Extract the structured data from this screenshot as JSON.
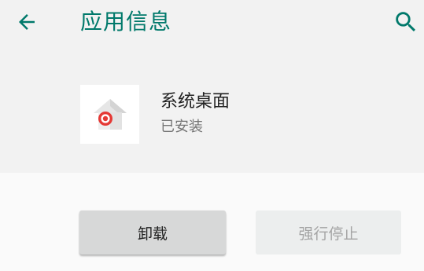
{
  "toolbar": {
    "title": "应用信息",
    "back_icon": "arrow-back-icon",
    "search_icon": "search-icon",
    "accent_color": "#00796b"
  },
  "app": {
    "icon": "home-app-icon",
    "name": "系统桌面",
    "status": "已安装"
  },
  "actions": {
    "uninstall_label": "卸载",
    "force_stop_label": "强行停止"
  }
}
